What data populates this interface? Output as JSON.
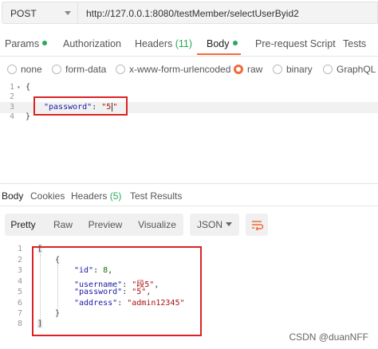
{
  "request": {
    "method": "POST",
    "url": "http://127.0.0.1:8080/testMember/selectUserByid2"
  },
  "request_tabs": [
    {
      "label": "Params",
      "dot": true
    },
    {
      "label": "Authorization"
    },
    {
      "label": "Headers",
      "count": "(11)"
    },
    {
      "label": "Body",
      "dot": true,
      "active": true
    },
    {
      "label": "Pre-request Script"
    },
    {
      "label": "Tests"
    }
  ],
  "body_types": [
    {
      "label": "none"
    },
    {
      "label": "form-data"
    },
    {
      "label": "x-www-form-urlencoded"
    },
    {
      "label": "raw",
      "selected": true
    },
    {
      "label": "binary"
    },
    {
      "label": "GraphQL"
    }
  ],
  "request_body": {
    "lines": [
      "1",
      "2",
      "3",
      "4"
    ],
    "open_brace": "{",
    "key": "\"password\"",
    "colon": ": ",
    "value_open": "\"5",
    "value_close": "\"",
    "close_brace": "}"
  },
  "response_tabs": [
    {
      "label": "Body",
      "active": true
    },
    {
      "label": "Cookies"
    },
    {
      "label": "Headers",
      "count": "(5)"
    },
    {
      "label": "Test Results"
    }
  ],
  "response_toolbar": {
    "views": [
      "Pretty",
      "Raw",
      "Preview",
      "Visualize"
    ],
    "format": "JSON"
  },
  "response_body": {
    "lines": [
      "1",
      "2",
      "3",
      "4",
      "5",
      "6",
      "7",
      "8"
    ],
    "open_bracket": "[",
    "open_brace": "{",
    "id_key": "\"id\"",
    "id_value": "8",
    "username_key": "\"username\"",
    "username_value": "\"段5\"",
    "password_key": "\"password\"",
    "password_value": "\"5\"",
    "address_key": "\"address\"",
    "address_value": "\"admin12345\"",
    "close_brace": "}",
    "close_bracket": "]"
  },
  "watermark": "CSDN @duanNFF",
  "colors": {
    "accent": "#f26b3a",
    "status_green": "#27a957",
    "highlight_red": "#dd2222"
  }
}
